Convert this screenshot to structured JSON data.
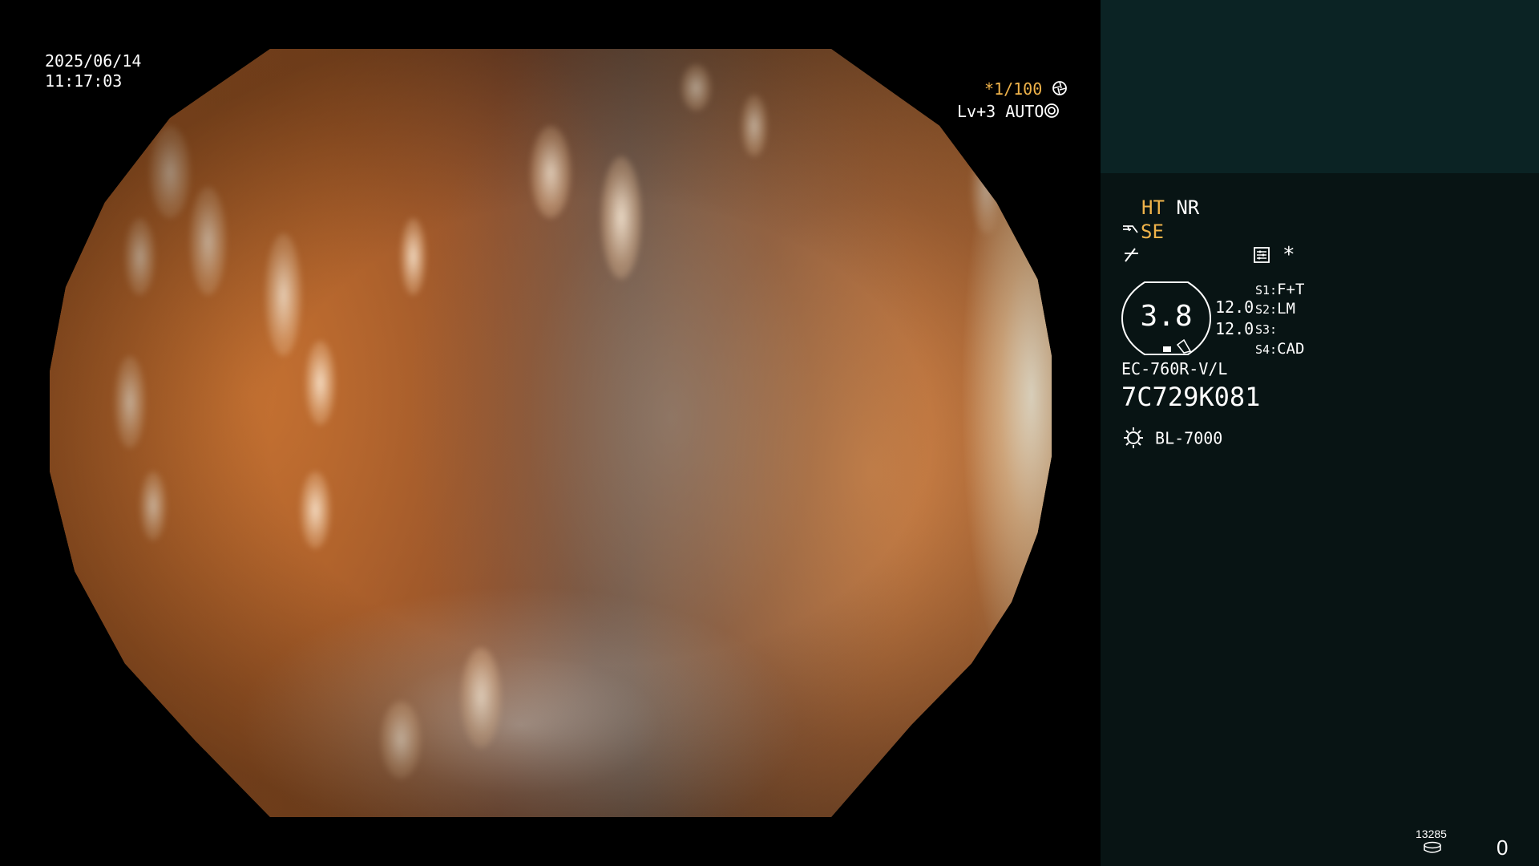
{
  "datetime": {
    "date": "2025/06/14",
    "time": "11:17:03"
  },
  "shutter": {
    "value": "*1/100"
  },
  "exposure": {
    "level": "Lv+3",
    "mode": "AUTO"
  },
  "image_processing": {
    "ht": "HT",
    "nr": "NR",
    "se": "SE"
  },
  "scope": {
    "value": "3.8",
    "readout_1": "12.0",
    "readout_2": "12.0",
    "switches": [
      {
        "key": "S1:",
        "value": "F+T"
      },
      {
        "key": "S2:",
        "value": "LM"
      },
      {
        "key": "S3:",
        "value": ""
      },
      {
        "key": "S4:",
        "value": "CAD"
      }
    ],
    "model": "EC-760R-V/L",
    "serial": "7C729K081"
  },
  "light_source": {
    "model": "BL-7000"
  },
  "asterisk": "*",
  "storage": {
    "count": "13285",
    "index": "0"
  },
  "colors": {
    "accent": "#f0b34a",
    "panel_bg": "#081414",
    "panel_top_bg": "#0b2324"
  },
  "icons": {
    "shutter": "aperture-icon",
    "auto": "iris-icon",
    "se": "scope-tip-icon",
    "line": "zoom-line-icon",
    "menu": "settings-sheet-icon",
    "light": "lamp-icon",
    "storage": "storage-disk-icon"
  }
}
